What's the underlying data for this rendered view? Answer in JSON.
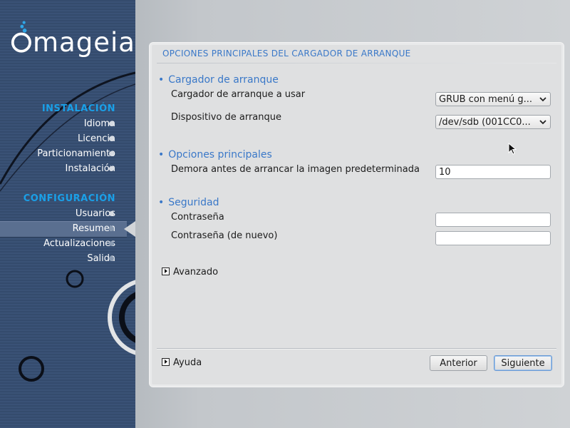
{
  "brand": {
    "name": "mageia"
  },
  "sidebar": {
    "install_title": "INSTALACIÓN",
    "install_steps": [
      {
        "label": "Idioma"
      },
      {
        "label": "Licencia"
      },
      {
        "label": "Particionamiento"
      },
      {
        "label": "Instalación"
      }
    ],
    "config_title": "CONFIGURACIÓN",
    "config_steps": [
      {
        "label": "Usuarios"
      },
      {
        "label": "Resumen"
      },
      {
        "label": "Actualizaciones"
      },
      {
        "label": "Salida"
      }
    ],
    "current_step": "Resumen"
  },
  "panel": {
    "title": "OPCIONES PRINCIPALES DEL CARGADOR DE ARRANQUE",
    "bootloader_group": {
      "title": "Cargador de arranque",
      "loader_label": "Cargador de arranque a usar",
      "loader_value": "GRUB con menú g...",
      "device_label": "Dispositivo de arranque",
      "device_value": "/dev/sdb (001CC0..."
    },
    "main_group": {
      "title": "Opciones principales",
      "delay_label": "Demora antes de arrancar la imagen predeterminada",
      "delay_value": "10"
    },
    "security_group": {
      "title": "Seguridad",
      "password_label": "Contraseña",
      "password_value": "",
      "password_again_label": "Contraseña (de nuevo)",
      "password_again_value": ""
    },
    "advanced_label": "Avanzado",
    "help_label": "Ayuda",
    "previous_label": "Anterior",
    "next_label": "Siguiente"
  },
  "icons": {
    "bullet": "•",
    "expander": "expander-arrow-icon",
    "combo": "chevron-down-icon",
    "cursor": "mouse-pointer-icon"
  },
  "colors": {
    "accent_blue": "#3a78c8",
    "sidebar_section": "#1aa0e8",
    "sidebar_bg": "#3a5276"
  }
}
